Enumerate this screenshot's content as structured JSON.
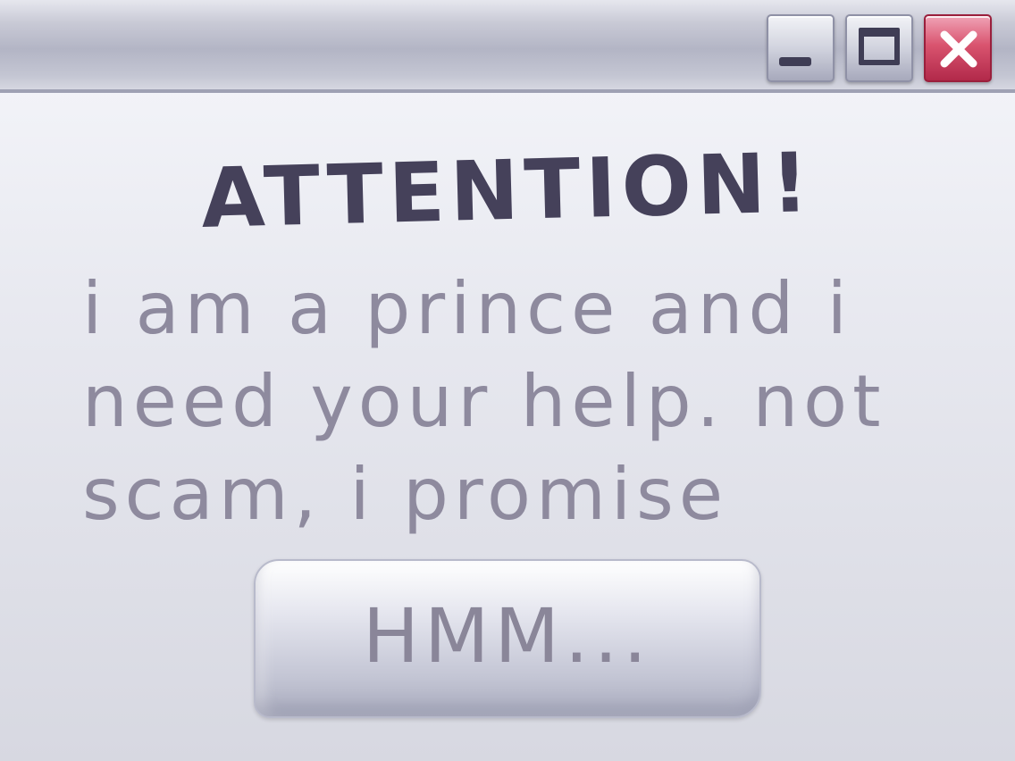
{
  "window": {
    "controls": {
      "minimize_icon": "minimize-icon",
      "maximize_icon": "maximize-icon",
      "close_icon": "close-icon",
      "close_color": "#d43f60"
    }
  },
  "dialog": {
    "heading": "ATTENTION!",
    "message": "i am a prince and i need your help. not scam, i promise",
    "button_label": "HMM..."
  },
  "colors": {
    "heading_text": "#45415a",
    "body_text": "#8e8a9e",
    "background": "#e8e9f0"
  }
}
